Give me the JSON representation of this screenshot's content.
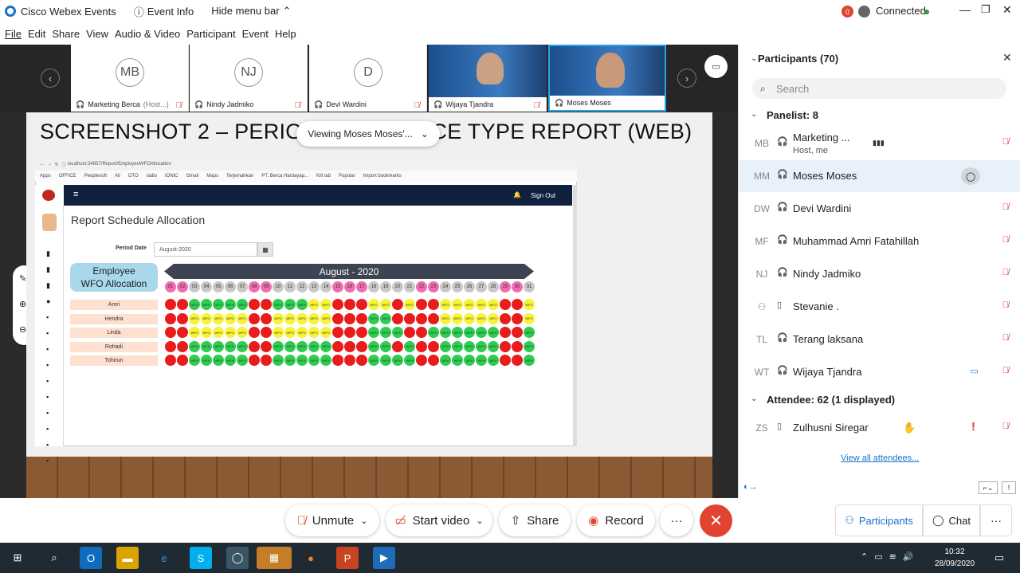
{
  "titlebar": {
    "app_name": "Cisco Webex Events",
    "event_info": "Event Info",
    "hide_menu": "Hide menu bar",
    "rec_badge": "0",
    "status": "Connected"
  },
  "menu": [
    "File",
    "Edit",
    "Share",
    "View",
    "Audio & Video",
    "Participant",
    "Event",
    "Help"
  ],
  "thumbnails": [
    {
      "initials": "MB",
      "name": "Marketing Berca",
      "suffix": "(Host...)"
    },
    {
      "initials": "NJ",
      "name": "Nindy Jadmiko",
      "suffix": ""
    },
    {
      "initials": "D",
      "name": "Devi Wardini",
      "suffix": ""
    },
    {
      "initials": "",
      "name": "Wijaya Tjandra",
      "suffix": ""
    },
    {
      "initials": "",
      "name": "Moses Moses",
      "suffix": ""
    }
  ],
  "slide": {
    "title_left": "SCREENSHOT 2 – PERIOD",
    "title_right": "CE TYPE REPORT (WEB)",
    "viewing": "Viewing Moses Moses'..."
  },
  "browser": {
    "url": "localhost:34857/Report/EmployeeWFOAllocation",
    "bookmarks": [
      "Apps",
      "OFFICE",
      "Peoplesoft",
      "All",
      "OTO",
      "radio",
      "IONIC",
      "Gmail",
      "Maps",
      "Terjemahkan",
      "PT. Berca Hardayap...",
      "Kill tab",
      "Popular",
      "Import bookmarks"
    ],
    "signout": "Sign Out",
    "page_title": "Report Schedule Allocation",
    "period_label": "Period Date",
    "period_value": "August-2020",
    "wfo_title_1": "Employee",
    "wfo_title_2": "WFO Allocation",
    "month": "August - 2020",
    "days": [
      "01",
      "02",
      "03",
      "04",
      "05",
      "06",
      "07",
      "08",
      "09",
      "10",
      "11",
      "12",
      "13",
      "14",
      "15",
      "16",
      "17",
      "18",
      "19",
      "20",
      "21",
      "22",
      "23",
      "24",
      "25",
      "26",
      "27",
      "28",
      "29",
      "30",
      "31"
    ],
    "weekend_days": [
      1,
      2,
      8,
      9,
      15,
      16,
      17,
      22,
      23,
      29,
      30
    ],
    "employees": [
      {
        "name": "Amri",
        "row": "RRHHHHHRRHHHOORRROORORROOOOORRO"
      },
      {
        "name": "Hendra",
        "row": "RROOOOORROOOOORRRHHRRRROOOOORRO"
      },
      {
        "name": "Linda",
        "row": "RROOOOORROOOOORRRHHHRRHHHHHHRRH"
      },
      {
        "name": "Rohadi",
        "row": "RRHHHHHRRHHHHHRRRHHRHRRHHHHHRRH"
      },
      {
        "name": "Tohirun",
        "row": "RRHHHHHRRHHHHHRRRHHHHRRHHHHHRRH"
      }
    ],
    "cell_labels": {
      "H": "WFH",
      "O": "WFO",
      "R": ""
    }
  },
  "participants": {
    "title": "Participants (70)",
    "search_placeholder": "Search",
    "panelist_header": "Panelist: 8",
    "panelists": [
      {
        "initials": "MB",
        "name": "Marketing ...",
        "sub": "Host, me"
      },
      {
        "initials": "MM",
        "name": "Moses Moses",
        "sub": ""
      },
      {
        "initials": "DW",
        "name": "Devi Wardini",
        "sub": ""
      },
      {
        "initials": "MF",
        "name": "Muhammad Amri Fatahillah",
        "sub": ""
      },
      {
        "initials": "NJ",
        "name": "Nindy Jadmiko",
        "sub": ""
      },
      {
        "initials": "",
        "name": "Stevanie .",
        "sub": ""
      },
      {
        "initials": "TL",
        "name": "Terang laksana",
        "sub": ""
      },
      {
        "initials": "WT",
        "name": "Wijaya Tjandra",
        "sub": ""
      }
    ],
    "attendee_header": "Attendee: 62 (1 displayed)",
    "attendees": [
      {
        "initials": "ZS",
        "name": "Zulhusni Siregar"
      }
    ],
    "view_all": "View all attendees..."
  },
  "controls": {
    "unmute": "Unmute",
    "start_video": "Start video",
    "share": "Share",
    "record": "Record",
    "more": "···",
    "participants": "Participants",
    "chat": "Chat"
  },
  "taskbar": {
    "time": "10:32",
    "date": "28/09/2020"
  },
  "colors": {
    "wfh": "#2ecc50",
    "wfo": "#f7f436",
    "off": "#e81c1c",
    "weekend_day": "#f06cb0",
    "normal_day": "#c8c8c8",
    "accent": "#1a73c9"
  }
}
